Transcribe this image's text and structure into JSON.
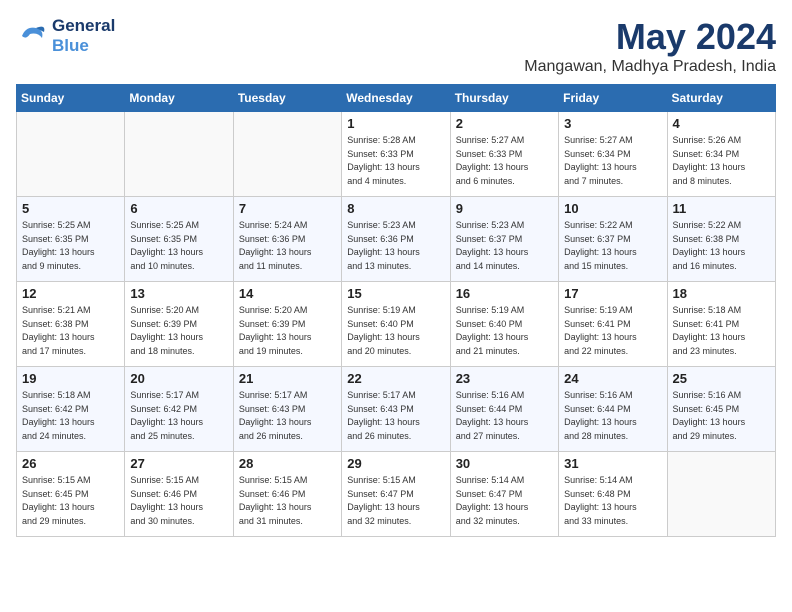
{
  "header": {
    "logo_line1": "General",
    "logo_line2": "Blue",
    "month": "May 2024",
    "location": "Mangawan, Madhya Pradesh, India"
  },
  "weekdays": [
    "Sunday",
    "Monday",
    "Tuesday",
    "Wednesday",
    "Thursday",
    "Friday",
    "Saturday"
  ],
  "weeks": [
    [
      {
        "day": "",
        "info": ""
      },
      {
        "day": "",
        "info": ""
      },
      {
        "day": "",
        "info": ""
      },
      {
        "day": "1",
        "info": "Sunrise: 5:28 AM\nSunset: 6:33 PM\nDaylight: 13 hours\nand 4 minutes."
      },
      {
        "day": "2",
        "info": "Sunrise: 5:27 AM\nSunset: 6:33 PM\nDaylight: 13 hours\nand 6 minutes."
      },
      {
        "day": "3",
        "info": "Sunrise: 5:27 AM\nSunset: 6:34 PM\nDaylight: 13 hours\nand 7 minutes."
      },
      {
        "day": "4",
        "info": "Sunrise: 5:26 AM\nSunset: 6:34 PM\nDaylight: 13 hours\nand 8 minutes."
      }
    ],
    [
      {
        "day": "5",
        "info": "Sunrise: 5:25 AM\nSunset: 6:35 PM\nDaylight: 13 hours\nand 9 minutes."
      },
      {
        "day": "6",
        "info": "Sunrise: 5:25 AM\nSunset: 6:35 PM\nDaylight: 13 hours\nand 10 minutes."
      },
      {
        "day": "7",
        "info": "Sunrise: 5:24 AM\nSunset: 6:36 PM\nDaylight: 13 hours\nand 11 minutes."
      },
      {
        "day": "8",
        "info": "Sunrise: 5:23 AM\nSunset: 6:36 PM\nDaylight: 13 hours\nand 13 minutes."
      },
      {
        "day": "9",
        "info": "Sunrise: 5:23 AM\nSunset: 6:37 PM\nDaylight: 13 hours\nand 14 minutes."
      },
      {
        "day": "10",
        "info": "Sunrise: 5:22 AM\nSunset: 6:37 PM\nDaylight: 13 hours\nand 15 minutes."
      },
      {
        "day": "11",
        "info": "Sunrise: 5:22 AM\nSunset: 6:38 PM\nDaylight: 13 hours\nand 16 minutes."
      }
    ],
    [
      {
        "day": "12",
        "info": "Sunrise: 5:21 AM\nSunset: 6:38 PM\nDaylight: 13 hours\nand 17 minutes."
      },
      {
        "day": "13",
        "info": "Sunrise: 5:20 AM\nSunset: 6:39 PM\nDaylight: 13 hours\nand 18 minutes."
      },
      {
        "day": "14",
        "info": "Sunrise: 5:20 AM\nSunset: 6:39 PM\nDaylight: 13 hours\nand 19 minutes."
      },
      {
        "day": "15",
        "info": "Sunrise: 5:19 AM\nSunset: 6:40 PM\nDaylight: 13 hours\nand 20 minutes."
      },
      {
        "day": "16",
        "info": "Sunrise: 5:19 AM\nSunset: 6:40 PM\nDaylight: 13 hours\nand 21 minutes."
      },
      {
        "day": "17",
        "info": "Sunrise: 5:19 AM\nSunset: 6:41 PM\nDaylight: 13 hours\nand 22 minutes."
      },
      {
        "day": "18",
        "info": "Sunrise: 5:18 AM\nSunset: 6:41 PM\nDaylight: 13 hours\nand 23 minutes."
      }
    ],
    [
      {
        "day": "19",
        "info": "Sunrise: 5:18 AM\nSunset: 6:42 PM\nDaylight: 13 hours\nand 24 minutes."
      },
      {
        "day": "20",
        "info": "Sunrise: 5:17 AM\nSunset: 6:42 PM\nDaylight: 13 hours\nand 25 minutes."
      },
      {
        "day": "21",
        "info": "Sunrise: 5:17 AM\nSunset: 6:43 PM\nDaylight: 13 hours\nand 26 minutes."
      },
      {
        "day": "22",
        "info": "Sunrise: 5:17 AM\nSunset: 6:43 PM\nDaylight: 13 hours\nand 26 minutes."
      },
      {
        "day": "23",
        "info": "Sunrise: 5:16 AM\nSunset: 6:44 PM\nDaylight: 13 hours\nand 27 minutes."
      },
      {
        "day": "24",
        "info": "Sunrise: 5:16 AM\nSunset: 6:44 PM\nDaylight: 13 hours\nand 28 minutes."
      },
      {
        "day": "25",
        "info": "Sunrise: 5:16 AM\nSunset: 6:45 PM\nDaylight: 13 hours\nand 29 minutes."
      }
    ],
    [
      {
        "day": "26",
        "info": "Sunrise: 5:15 AM\nSunset: 6:45 PM\nDaylight: 13 hours\nand 29 minutes."
      },
      {
        "day": "27",
        "info": "Sunrise: 5:15 AM\nSunset: 6:46 PM\nDaylight: 13 hours\nand 30 minutes."
      },
      {
        "day": "28",
        "info": "Sunrise: 5:15 AM\nSunset: 6:46 PM\nDaylight: 13 hours\nand 31 minutes."
      },
      {
        "day": "29",
        "info": "Sunrise: 5:15 AM\nSunset: 6:47 PM\nDaylight: 13 hours\nand 32 minutes."
      },
      {
        "day": "30",
        "info": "Sunrise: 5:14 AM\nSunset: 6:47 PM\nDaylight: 13 hours\nand 32 minutes."
      },
      {
        "day": "31",
        "info": "Sunrise: 5:14 AM\nSunset: 6:48 PM\nDaylight: 13 hours\nand 33 minutes."
      },
      {
        "day": "",
        "info": ""
      }
    ]
  ]
}
